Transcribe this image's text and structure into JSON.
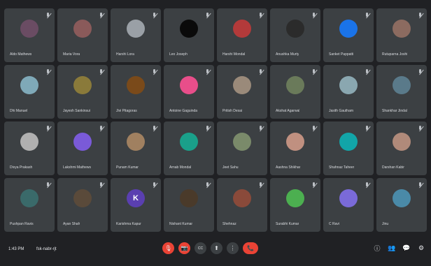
{
  "participants": [
    {
      "name": "Aldo Mathews",
      "avatar_color": "#6a4c63"
    },
    {
      "name": "Maria Vora",
      "avatar_color": "#8a5a5a"
    },
    {
      "name": "Harshi Lora",
      "avatar_color": "#9aa0a6"
    },
    {
      "name": "Leo Joseph",
      "avatar_color": "#0a0a0a"
    },
    {
      "name": "Harshi Mondal",
      "avatar_color": "#b33a3a"
    },
    {
      "name": "Anushka Murty",
      "avatar_color": "#2b2b2b"
    },
    {
      "name": "Sanket Pappatti",
      "avatar_color": "#1a73e8"
    },
    {
      "name": "Rutuparna Joshi",
      "avatar_color": "#8c6b60"
    },
    {
      "name": "Dhi Manuel",
      "avatar_color": "#7fa9b8"
    },
    {
      "name": "Jayesh Sankinsui",
      "avatar_color": "#8a7a3a"
    },
    {
      "name": "Jivi Pitagoras",
      "avatar_color": "#7a4a1a"
    },
    {
      "name": "Antoine Gaguinda",
      "avatar_color": "#e84e8a"
    },
    {
      "name": "Pritish Desai",
      "avatar_color": "#9a8a7a"
    },
    {
      "name": "Akshat Agarwal",
      "avatar_color": "#6a7a5a"
    },
    {
      "name": "Jasith Gautham",
      "avatar_color": "#8aa7b0"
    },
    {
      "name": "Shankhar Jindal",
      "avatar_color": "#5a7a8a"
    },
    {
      "name": "Divya Prakash",
      "avatar_color": "#b0b0b0"
    },
    {
      "name": "Lakshmi Mathews",
      "avatar_color": "#7a5ad8"
    },
    {
      "name": "Punam Kumar",
      "avatar_color": "#a08060"
    },
    {
      "name": "Arnab Mondal",
      "avatar_color": "#1aa08a"
    },
    {
      "name": "Jeet Sahu",
      "avatar_color": "#7a8a6a"
    },
    {
      "name": "Aashna Shikhar",
      "avatar_color": "#c09080"
    },
    {
      "name": "Shahnaz Taheer",
      "avatar_color": "#12a5a8"
    },
    {
      "name": "Darshan Kabir",
      "avatar_color": "#b08a7a"
    },
    {
      "name": "Pushpan Ravis",
      "avatar_color": "#3a6a6a"
    },
    {
      "name": "Ayan Shah",
      "avatar_color": "#5a4a3a"
    },
    {
      "name": "Karishma Kapur",
      "avatar_color": "#5a3fb0",
      "initial": "K"
    },
    {
      "name": "Nishant Kumar",
      "avatar_color": "#4a3a2a"
    },
    {
      "name": "Shehnaz",
      "avatar_color": "#8a4a3a"
    },
    {
      "name": "Surabhi Kumar",
      "avatar_color": "#4caf50"
    },
    {
      "name": "C Ravi",
      "avatar_color": "#7a6ad8"
    },
    {
      "name": "Jinu",
      "avatar_color": "#4a8aa8"
    }
  ],
  "bottombar": {
    "time": "1:43 PM",
    "meeting_code": "fsk-nabr-rjt"
  },
  "controls": {
    "mic": "🎙",
    "camera": "📷",
    "captions": "CC",
    "present": "⬆",
    "more": "⋮",
    "leave": "📞"
  },
  "right_icons": {
    "info": "ⓘ",
    "people": "👥",
    "chat": "💬",
    "activities": "⚙"
  }
}
